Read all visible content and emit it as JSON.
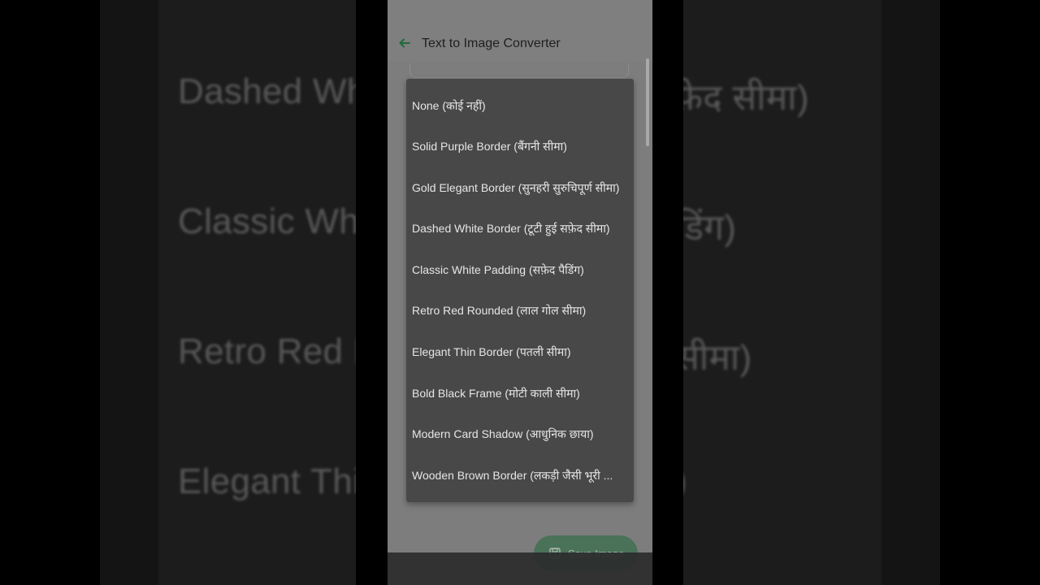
{
  "background": {
    "left_fragments": [
      "Dashed Wh",
      "Classic Wh",
      "Retro Red B",
      "Elegant Thi"
    ],
    "right_fragments": [
      "फ़ेद सीमा)",
      "डिंग)",
      "सीमा)",
      ")"
    ]
  },
  "app_bar": {
    "title": "Text to Image Converter"
  },
  "menu": {
    "items": [
      "None (कोई नहीं)",
      "Solid Purple Border (बैंगनी सीमा)",
      "Gold Elegant Border (सुनहरी सुरुचिपूर्ण सीमा)",
      "Dashed White Border (टूटी हुई सफ़ेद सीमा)",
      "Classic White Padding (सफ़ेद पैडिंग)",
      "Retro Red Rounded (लाल गोल सीमा)",
      "Elegant Thin Border (पतली सीमा)",
      "Bold Black Frame (मोटी काली सीमा)",
      "Modern Card Shadow (आधुनिक छाया)",
      "Wooden Brown Border (लकड़ी जैसी भूरी ..."
    ]
  },
  "save_button": {
    "label": "Save Image"
  },
  "colors": {
    "accent": "#2e7d46",
    "menu_bg": "#484848"
  }
}
